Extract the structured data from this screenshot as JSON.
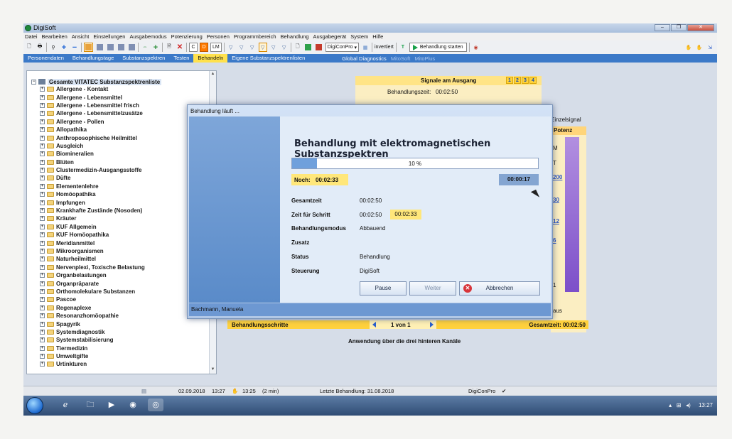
{
  "window": {
    "title": "DigiSoft"
  },
  "menu": [
    "Datei",
    "Bearbeiten",
    "Ansicht",
    "Einstellungen",
    "Ausgabemodus",
    "Potenzierung",
    "Personen",
    "Programmbereich",
    "Behandlung",
    "Ausgabegerät",
    "System",
    "Hilfe"
  ],
  "toolbar": {
    "c_label": "C",
    "d_label": "D",
    "lm_label": "LM",
    "device": "DigiConPro",
    "inverted": "invertiert",
    "start_label": "Behandlung starten"
  },
  "tabs": [
    "Personendaten",
    "Behandlungstage",
    "Substanzspektren",
    "Testen",
    "Behandeln",
    "Eigene Substanzspektrenlisten"
  ],
  "tabs_right": {
    "gd": "Global Diagnostics",
    "mitosoft": "MitoSoft",
    "mitoplus": "MitoPlus"
  },
  "tree": {
    "root": "Gesamte VITATEC Substanzspektrenliste",
    "items": [
      "Allergene - Kontakt",
      "Allergene - Lebensmittel",
      "Allergene - Lebensmittel frisch",
      "Allergene - Lebensmittelzusätze",
      "Allergene - Pollen",
      "Allopathika",
      "Anthroposophische Heilmittel",
      "Ausgleich",
      "Biomineralien",
      "Blüten",
      "Clustermedizin-Ausgangsstoffe",
      "Düfte",
      "Elementenlehre",
      "Homöopathika",
      "Impfungen",
      "Krankhafte Zustände (Nosoden)",
      "Kräuter",
      "KUF Allgemein",
      "KUF Homöopathika",
      "Meridianmittel",
      "Mikroorganismen",
      "Naturheilmittel",
      "Nervenplexi, Toxische Belastung",
      "Organbelastungen",
      "Organpräparate",
      "Orthomolekulare Substanzen",
      "Pascoe",
      "Regenaplexe",
      "Resonanzhomöopathie",
      "Spagyrik",
      "Systemdiagnostik",
      "Systemstabilisierung",
      "Tiermedizin",
      "Umweltgifte",
      "Urtinkturen"
    ]
  },
  "signal": {
    "title": "Signale am Ausgang",
    "channels": [
      "1",
      "2",
      "3",
      "4"
    ],
    "zeit_label": "Behandlungszeit:",
    "zeit_value": "00:02:50"
  },
  "right_panel": {
    "einzelsignal": "Einzelsignal",
    "potenz": "Potenz",
    "labels": [
      "M",
      "T",
      "200",
      "30",
      "12",
      "6",
      "1"
    ],
    "aus": "aus"
  },
  "steps": {
    "label": "Behandlungsschritte",
    "nav": "1 von 1",
    "total": "Gesamtzeit: 00:02:50"
  },
  "anwendung": "Anwendung über die drei hinteren Kanäle",
  "dialog": {
    "title": "Behandlung läuft ...",
    "heading": "Behandlung mit elektromagnetischen Substanzspektren",
    "progress_text": "10 %",
    "progress_fraction": 0.1,
    "noch_label": "Noch:",
    "noch_value": "00:02:33",
    "elapsed": "00:00:17",
    "rows": [
      {
        "label": "Gesamtzeit",
        "value": "00:02:50"
      },
      {
        "label": "Zeit für Schritt",
        "value": "00:02:50"
      },
      {
        "label": "Behandlungsmodus",
        "value": "Abbauend"
      },
      {
        "label": "Zusatz",
        "value": ""
      },
      {
        "label": "Status",
        "value": "Behandlung"
      },
      {
        "label": "Steuerung",
        "value": "DigiSoft"
      }
    ],
    "step_remaining": "00:02:33",
    "buttons": {
      "pause": "Pause",
      "weiter": "Weiter",
      "abbrechen": "Abbrechen"
    },
    "footer": "Bachmann, Manuela"
  },
  "statusbar": {
    "date": "02.09.2018",
    "time1": "13:27",
    "time2": "13:25",
    "duration": "(2 min)",
    "last": "Letzte Behandlung: 31.08.2018",
    "device": "DigiConPro",
    "check": "✔"
  },
  "taskbar": {
    "clock": "13:27"
  }
}
